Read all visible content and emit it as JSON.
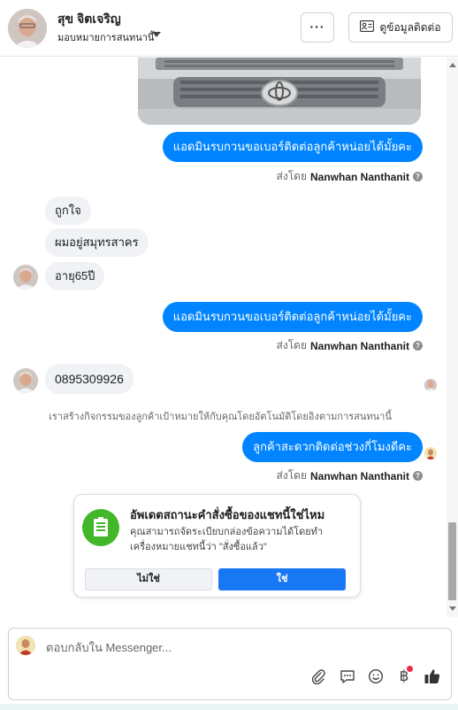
{
  "header": {
    "name": "สุข จิตเจริญ",
    "assign_label": "มอบหมายการสนทนานี้",
    "more_label": "···",
    "contact_info_label": "ดูข้อมูลติดต่อ"
  },
  "messages": {
    "out_1": "แอดมินรบกวนขอเบอร์ติดต่อลูกค้าหน่อยได้มั้ยคะ",
    "in_1": "ถูกใจ",
    "in_2": "ผมอยู่สมุทรสาคร",
    "in_3": "อายุ65ปี",
    "out_2": "แอดมินรบกวนขอเบอร์ติดต่อลูกค้าหน่อยได้มั้ยคะ",
    "in_4": "0895309926",
    "out_3": "ลูกค้าสะดวกติดต่อช่วงกี่โมงดีคะ"
  },
  "sent_by": {
    "prefix": "ส่งโดย",
    "name": "Nanwhan Nanthanit",
    "info_glyph": "?"
  },
  "notice": "เราสร้างกิจกรรมของลูกค้าเป้าหมายให้กับคุณโดยอัตโนมัติโดยอิงตามการสนทนานี้",
  "order_card": {
    "title": "อัพเดตสถานะคำสั่งซื้อของแชทนี้ใช่ไหม",
    "body": "คุณสามารถจัดระเบียบกล่องข้อความได้โดยทำเครื่องหมายแชทนี้ว่า \"สั่งซื้อแล้ว\"",
    "no_label": "ไม่ใช่",
    "yes_label": "ใช่",
    "icon": "receipt-icon",
    "accent": "#42b72a"
  },
  "composer": {
    "placeholder": "ตอบกลับใน Messenger...",
    "tools": [
      "paperclip-icon",
      "chat-bubble-icon",
      "smiley-icon",
      "baht-icon",
      "thumbs-up-icon"
    ],
    "baht_glyph": "฿"
  },
  "colors": {
    "outgoing_bubble": "#0084ff",
    "incoming_bubble": "#f0f2f5",
    "primary_button": "#1877f2",
    "notification_dot": "#f02849"
  }
}
